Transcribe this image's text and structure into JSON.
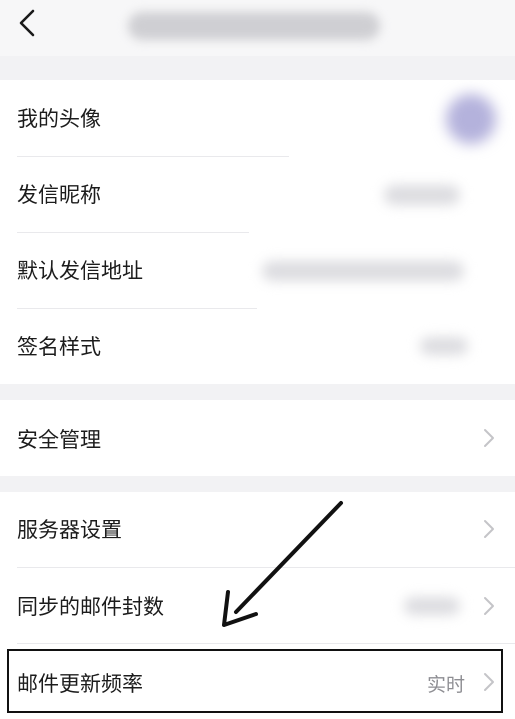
{
  "header": {
    "back_icon": "chevron-left-icon"
  },
  "profile_section": {
    "items": [
      {
        "label": "我的头像"
      },
      {
        "label": "发信昵称"
      },
      {
        "label": "默认发信地址"
      },
      {
        "label": "签名样式"
      }
    ]
  },
  "security_section": {
    "items": [
      {
        "label": "安全管理"
      }
    ]
  },
  "server_section": {
    "items": [
      {
        "label": "服务器设置"
      },
      {
        "label": "同步的邮件封数"
      },
      {
        "label": "邮件更新频率",
        "value": "实时"
      }
    ]
  },
  "colors": {
    "background": "#f2f2f4",
    "card": "#ffffff",
    "chevron": "#c4c4c8",
    "value_text": "#8e8e93",
    "annotation": "#111111"
  }
}
